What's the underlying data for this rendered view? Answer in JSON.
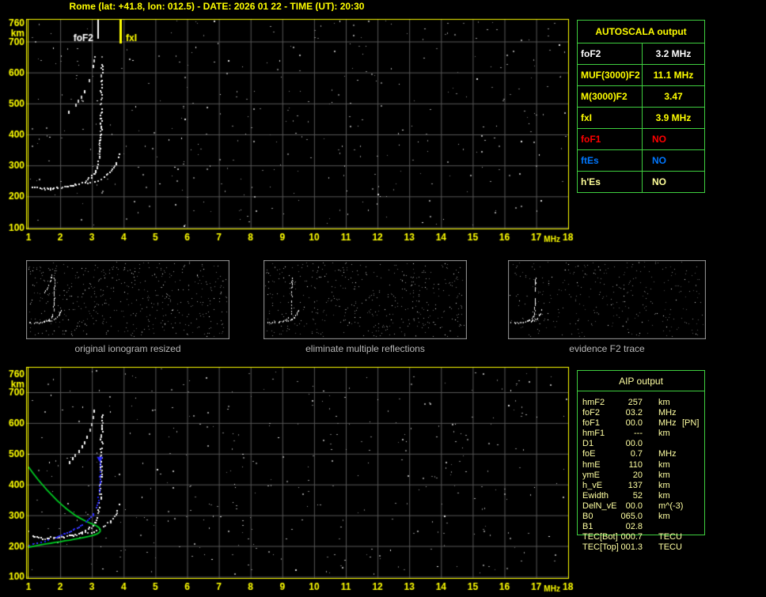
{
  "title": "Rome (lat: +41.8, lon: 012.5) - DATE: 2026 01 22 - TIME (UT): 20:30",
  "colors": {
    "yellow": "#ffff00",
    "pale_yellow": "#ffffa2",
    "table_green": "#3fcf3f",
    "grid_gray": "#565656",
    "frame_yellow": "#ffff00",
    "trace_white": "#ffffff",
    "curve_green": "#00cc22",
    "curve_blue": "#2a2aff",
    "red": "#ff0000",
    "es_blue": "#0077ff",
    "caption_gray": "#b8b8b8"
  },
  "autoscala": {
    "header": "AUTOSCALA output",
    "rows": [
      {
        "label": "foF2",
        "value": "3.2 MHz",
        "color": "#ffffff"
      },
      {
        "label": "MUF(3000)F2",
        "value": "11.1 MHz",
        "color": "#ffff00"
      },
      {
        "label": "M(3000)F2",
        "value": "3.47",
        "color": "#ffff00"
      },
      {
        "label": "fxI",
        "value": "3.9 MHz",
        "color": "#ffff00"
      },
      {
        "label": "foF1",
        "value": "NO",
        "color": "#ff0000"
      },
      {
        "label": "ftEs",
        "value": "NO",
        "color": "#0077ff"
      },
      {
        "label": "h'Es",
        "value": "NO",
        "color": "#ffff99"
      }
    ]
  },
  "aip": {
    "header": "AIP output",
    "rows": [
      {
        "label": "hmF2",
        "value": "257",
        "unit": "km",
        "extra": ""
      },
      {
        "label": "foF2",
        "value": "03.2",
        "unit": "MHz",
        "extra": ""
      },
      {
        "label": "foF1",
        "value": "00.0",
        "unit": "MHz",
        "extra": "[PN]"
      },
      {
        "label": "hmF1",
        "value": "---",
        "unit": "km",
        "extra": ""
      },
      {
        "label": "D1",
        "value": "00.0",
        "unit": "",
        "extra": ""
      },
      {
        "label": "foE",
        "value": "0.7",
        "unit": "MHz",
        "extra": ""
      },
      {
        "label": "hmE",
        "value": "110",
        "unit": "km",
        "extra": ""
      },
      {
        "label": "ymE",
        "value": "20",
        "unit": "km",
        "extra": ""
      },
      {
        "label": "h_vE",
        "value": "137",
        "unit": "km",
        "extra": ""
      },
      {
        "label": "Ewidth",
        "value": "52",
        "unit": "km",
        "extra": ""
      },
      {
        "label": "DelN_vE",
        "value": "00.0",
        "unit": "m^(-3)",
        "extra": ""
      },
      {
        "label": "B0",
        "value": "065.0",
        "unit": "km",
        "extra": ""
      },
      {
        "label": "B1",
        "value": "02.8",
        "unit": "",
        "extra": ""
      },
      {
        "label": "TEC[Bot]",
        "value": "000.7",
        "unit": "TECU",
        "extra": ""
      },
      {
        "label": "TEC[Top]",
        "value": "001.3",
        "unit": "TECU",
        "extra": ""
      }
    ]
  },
  "thumbnails": [
    {
      "caption": "original ionogram resized"
    },
    {
      "caption": "eliminate multiple reflections"
    },
    {
      "caption": "evidence F2 trace"
    }
  ],
  "chart_data": {
    "type": "scatter",
    "title": "ionogram virtual height vs frequency",
    "xlabel": "MHz",
    "ylabel": "km",
    "xlim": [
      1,
      18
    ],
    "ylim": [
      100,
      760
    ],
    "grid": true,
    "x_ticks": [
      1,
      2,
      3,
      4,
      5,
      6,
      7,
      8,
      9,
      10,
      11,
      12,
      13,
      14,
      15,
      16,
      17,
      18
    ],
    "y_ticks": [
      700,
      600,
      500,
      400,
      300,
      200,
      100
    ],
    "y_top_tick": 760,
    "markers": [
      {
        "label": "foF2",
        "f": 3.2,
        "color": "#ffffff",
        "len": 25,
        "lw": 2,
        "side": "left"
      },
      {
        "label": "fxI",
        "f": 3.9,
        "color": "#ffff00",
        "len": 31,
        "lw": 3,
        "side": "right"
      }
    ],
    "traces": {
      "o_mode": [
        [
          1.1,
          232
        ],
        [
          1.2,
          230
        ],
        [
          1.35,
          228
        ],
        [
          1.5,
          227
        ],
        [
          1.65,
          228
        ],
        [
          1.8,
          229
        ],
        [
          1.95,
          230
        ],
        [
          2.1,
          232
        ],
        [
          2.25,
          235
        ],
        [
          2.4,
          238
        ],
        [
          2.5,
          241
        ],
        [
          2.6,
          244
        ],
        [
          2.7,
          248
        ],
        [
          2.8,
          253
        ],
        [
          2.9,
          259
        ],
        [
          3.0,
          268
        ],
        [
          3.07,
          277
        ],
        [
          3.12,
          288
        ],
        [
          3.16,
          300
        ],
        [
          3.19,
          315
        ],
        [
          3.21,
          332
        ],
        [
          3.23,
          352
        ],
        [
          3.24,
          374
        ],
        [
          3.25,
          398
        ],
        [
          3.26,
          424
        ],
        [
          3.27,
          452
        ],
        [
          3.275,
          480
        ],
        [
          3.28,
          508
        ],
        [
          3.285,
          535
        ],
        [
          3.29,
          560
        ],
        [
          3.29,
          585
        ],
        [
          3.295,
          610
        ],
        [
          3.3,
          635
        ]
      ],
      "x_mode": [
        [
          2.85,
          243
        ],
        [
          2.95,
          246
        ],
        [
          3.05,
          249
        ],
        [
          3.15,
          253
        ],
        [
          3.25,
          258
        ],
        [
          3.35,
          264
        ],
        [
          3.45,
          271
        ],
        [
          3.55,
          280
        ],
        [
          3.63,
          290
        ],
        [
          3.7,
          300
        ],
        [
          3.76,
          312
        ],
        [
          3.8,
          324
        ],
        [
          3.83,
          336
        ],
        [
          3.85,
          348
        ]
      ],
      "second_hop": [
        [
          2.25,
          475
        ],
        [
          2.35,
          487
        ],
        [
          2.45,
          499
        ],
        [
          2.55,
          512
        ],
        [
          2.65,
          527
        ],
        [
          2.75,
          543
        ],
        [
          2.83,
          561
        ],
        [
          2.9,
          580
        ],
        [
          2.96,
          601
        ],
        [
          3.01,
          623
        ],
        [
          3.05,
          645
        ],
        [
          3.07,
          660
        ]
      ],
      "profile_green": [
        [
          1.0,
          457
        ],
        [
          1.15,
          436
        ],
        [
          1.3,
          416
        ],
        [
          1.45,
          398
        ],
        [
          1.6,
          380
        ],
        [
          1.75,
          364
        ],
        [
          1.9,
          348
        ],
        [
          2.05,
          334
        ],
        [
          2.2,
          321
        ],
        [
          2.35,
          309
        ],
        [
          2.5,
          298
        ],
        [
          2.65,
          289
        ],
        [
          2.8,
          281
        ],
        [
          2.95,
          274
        ],
        [
          3.05,
          270
        ],
        [
          3.15,
          265
        ],
        [
          3.22,
          260
        ],
        [
          3.26,
          254
        ],
        [
          3.26,
          248
        ],
        [
          3.22,
          243
        ],
        [
          3.15,
          239
        ],
        [
          3.05,
          235
        ],
        [
          2.9,
          231
        ],
        [
          2.75,
          228
        ],
        [
          2.6,
          225
        ],
        [
          2.45,
          222
        ],
        [
          2.3,
          219
        ],
        [
          2.15,
          217
        ],
        [
          2.0,
          214
        ],
        [
          1.85,
          212
        ],
        [
          1.7,
          209
        ],
        [
          1.55,
          207
        ],
        [
          1.4,
          204
        ],
        [
          1.25,
          201
        ],
        [
          1.1,
          198
        ],
        [
          1.0,
          196
        ]
      ],
      "restored_blue": [
        [
          1.0,
          205
        ],
        [
          1.12,
          208
        ],
        [
          1.24,
          211
        ],
        [
          1.36,
          214
        ],
        [
          1.48,
          218
        ],
        [
          1.6,
          222
        ],
        [
          1.72,
          226
        ],
        [
          1.84,
          230
        ],
        [
          1.96,
          235
        ],
        [
          2.08,
          240
        ],
        [
          2.2,
          245
        ],
        [
          2.32,
          251
        ],
        [
          2.44,
          257
        ],
        [
          2.56,
          264
        ],
        [
          2.68,
          272
        ],
        [
          2.8,
          281
        ],
        [
          2.9,
          291
        ],
        [
          3.0,
          303
        ],
        [
          3.07,
          315
        ],
        [
          3.12,
          328
        ],
        [
          3.16,
          343
        ],
        [
          3.19,
          360
        ],
        [
          3.21,
          378
        ],
        [
          3.225,
          398
        ],
        [
          3.235,
          420
        ],
        [
          3.24,
          442
        ],
        [
          3.245,
          462
        ],
        [
          3.25,
          478
        ]
      ],
      "blue_arrow": [
        3.25,
        482
      ]
    },
    "noise": {
      "main_count": 370,
      "analysis_count": 370,
      "thumb_counts": [
        500,
        460,
        330
      ]
    }
  }
}
